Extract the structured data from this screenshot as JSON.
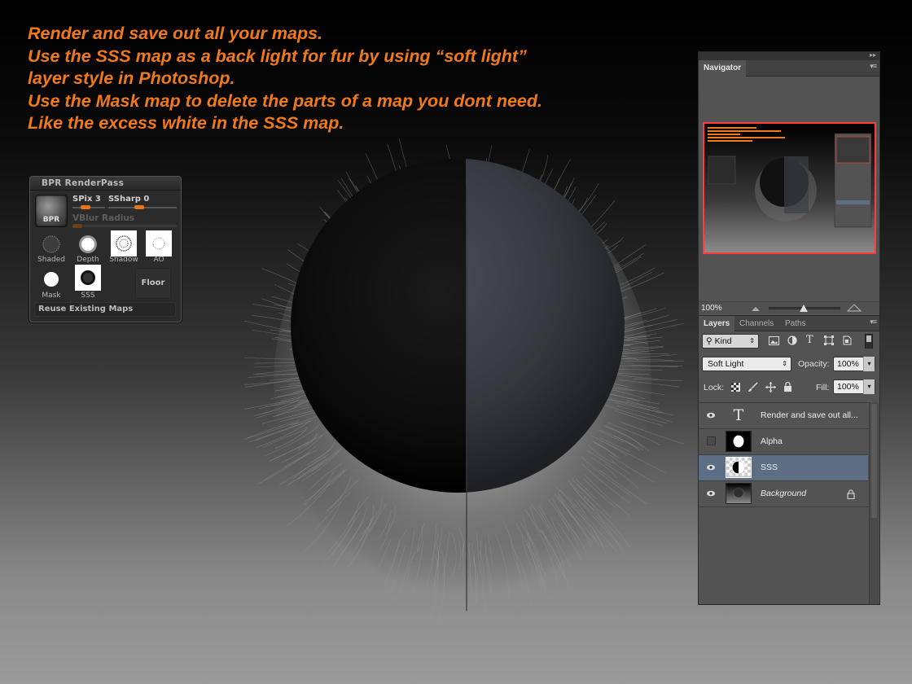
{
  "instructions": [
    "Render and save out all your maps.",
    "Use the SSS map as a back light for fur by using “soft light”",
    "layer style in Photoshop.",
    "Use the Mask map to delete the parts of a map you dont need.",
    "Like the excess white in the SSS map."
  ],
  "colors": {
    "accent": "#f07a1a",
    "selection": "#5e6e84",
    "navigator_frame": "#ff3b3b"
  },
  "bpr": {
    "title": "BPR RenderPass",
    "bpr_button": "BPR",
    "spix_label": "SPix 3",
    "ssharp_label": "SSharp 0",
    "vblur_label": "VBlur Radius",
    "maps": [
      "Shaded",
      "Depth",
      "Shadow",
      "AO",
      "Mask",
      "SSS"
    ],
    "floor_label": "Floor",
    "reuse_label": "Reuse Existing Maps"
  },
  "photoshop": {
    "navigator_tab": "Navigator",
    "zoom": "100%",
    "layer_tabs": [
      "Layers",
      "Channels",
      "Paths"
    ],
    "filter_kind": "Kind",
    "blend_mode": "Soft Light",
    "opacity_label": "Opacity:",
    "opacity_value": "100%",
    "lock_label": "Lock:",
    "fill_label": "Fill:",
    "fill_value": "100%",
    "layers": [
      {
        "name": "Render and save out all...",
        "type": "text",
        "visible": true
      },
      {
        "name": "Alpha",
        "type": "mask",
        "visible": false
      },
      {
        "name": "SSS",
        "type": "sss",
        "visible": true,
        "selected": true
      },
      {
        "name": "Background",
        "type": "background",
        "visible": true,
        "locked": true
      }
    ]
  }
}
